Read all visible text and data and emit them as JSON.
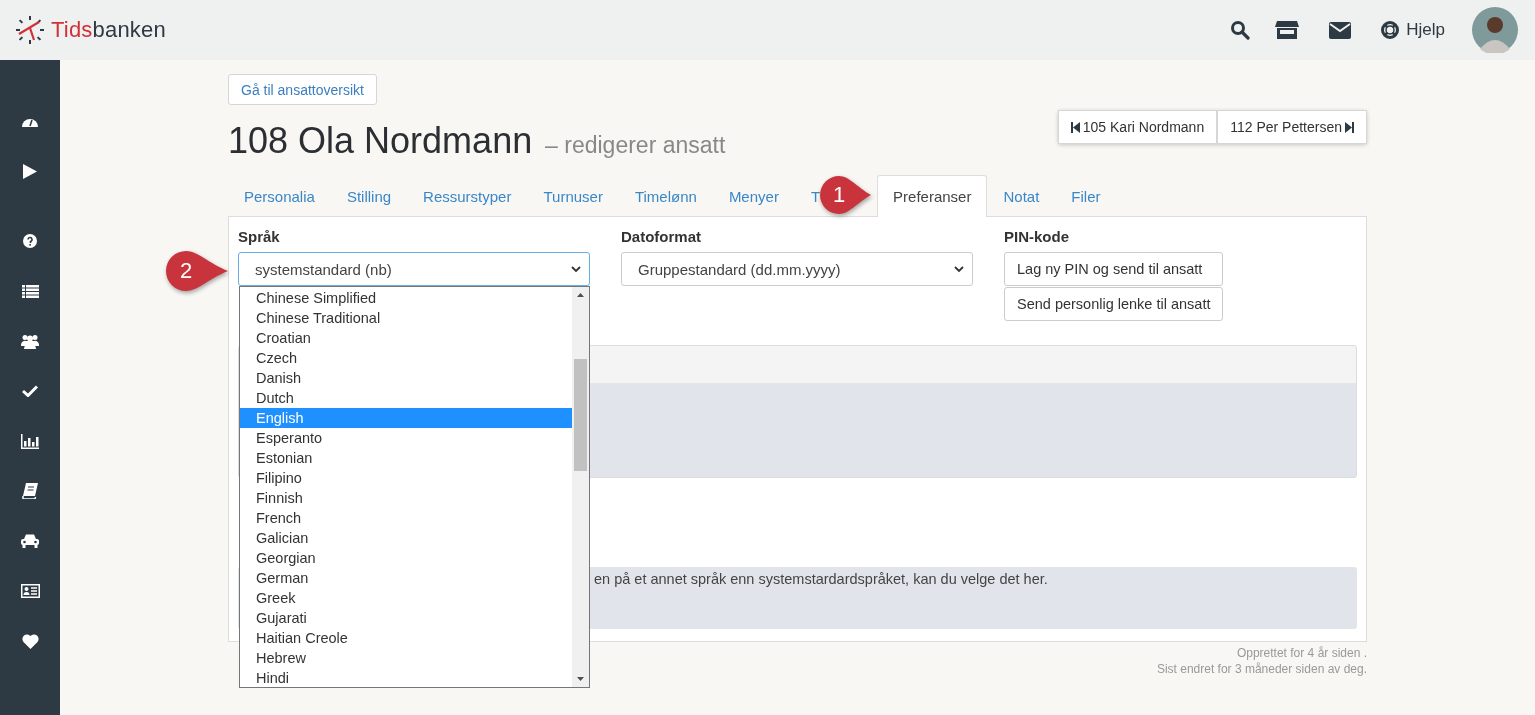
{
  "header": {
    "logo": {
      "part_red": "Tids",
      "part_dark": "banken"
    },
    "help_label": "Hjelp"
  },
  "back_button": "Gå til ansattoversikt",
  "title": {
    "name": "108 Ola Nordmann",
    "subtitle": "– redigerer ansatt"
  },
  "pager": {
    "previous": "105 Kari Nordmann",
    "next": "112 Per Pettersen"
  },
  "tabs": [
    {
      "label": "Personalia",
      "selected": false
    },
    {
      "label": "Stilling",
      "selected": false
    },
    {
      "label": "Ressurstyper",
      "selected": false
    },
    {
      "label": "Turnuser",
      "selected": false
    },
    {
      "label": "Timelønn",
      "selected": false
    },
    {
      "label": "Menyer",
      "selected": false
    },
    {
      "label": "T",
      "selected": false
    },
    {
      "label": "Preferanser",
      "selected": true
    },
    {
      "label": "Notat",
      "selected": false
    },
    {
      "label": "Filer",
      "selected": false
    }
  ],
  "callouts": [
    {
      "label": "1"
    },
    {
      "label": "2"
    }
  ],
  "language": {
    "label": "Språk",
    "value": "systemstandard (nb)",
    "expanded": true,
    "options": [
      {
        "label": "Chinese Simplified",
        "selected": false
      },
      {
        "label": "Chinese Traditional",
        "selected": false
      },
      {
        "label": "Croatian",
        "selected": false
      },
      {
        "label": "Czech",
        "selected": false
      },
      {
        "label": "Danish",
        "selected": false
      },
      {
        "label": "Dutch",
        "selected": false
      },
      {
        "label": "English",
        "selected": true
      },
      {
        "label": "Esperanto",
        "selected": false
      },
      {
        "label": "Estonian",
        "selected": false
      },
      {
        "label": "Filipino",
        "selected": false
      },
      {
        "label": "Finnish",
        "selected": false
      },
      {
        "label": "French",
        "selected": false
      },
      {
        "label": "Galician",
        "selected": false
      },
      {
        "label": "Georgian",
        "selected": false
      },
      {
        "label": "German",
        "selected": false
      },
      {
        "label": "Greek",
        "selected": false
      },
      {
        "label": "Gujarati",
        "selected": false
      },
      {
        "label": "Haitian Creole",
        "selected": false
      },
      {
        "label": "Hebrew",
        "selected": false
      },
      {
        "label": "Hindi",
        "selected": false
      }
    ]
  },
  "date_format": {
    "label": "Datoformat",
    "value": "Gruppestandard (dd.mm.yyyy)"
  },
  "pin": {
    "label": "PIN-kode",
    "buttons": [
      "Lag ny PIN og send til ansatt",
      "Send personlig lenke til ansatt"
    ]
  },
  "info_text": "en på et annet språk enn systemstardardspråket, kan du velge det her.",
  "footer": [
    "Opprettet for 4 år siden .",
    "Sist endret for 3 måneder siden av deg."
  ]
}
